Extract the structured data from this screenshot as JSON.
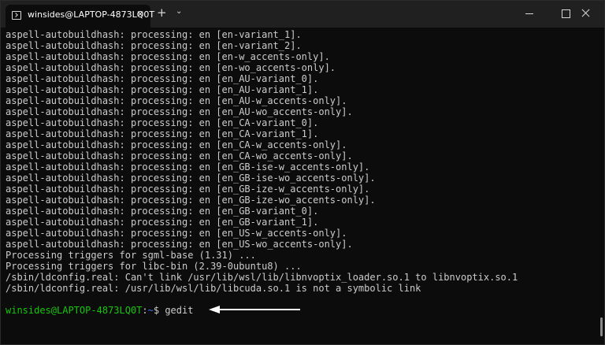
{
  "tab": {
    "title": "winsides@LAPTOP-4873LQ0T",
    "close": "✕"
  },
  "titlebar": {
    "new_tab": "+",
    "dropdown": "⌄"
  },
  "output": [
    "aspell-autobuildhash: processing: en [en-variant_1].",
    "aspell-autobuildhash: processing: en [en-variant_2].",
    "aspell-autobuildhash: processing: en [en-w_accents-only].",
    "aspell-autobuildhash: processing: en [en-wo_accents-only].",
    "aspell-autobuildhash: processing: en [en_AU-variant_0].",
    "aspell-autobuildhash: processing: en [en_AU-variant_1].",
    "aspell-autobuildhash: processing: en [en_AU-w_accents-only].",
    "aspell-autobuildhash: processing: en [en_AU-wo_accents-only].",
    "aspell-autobuildhash: processing: en [en_CA-variant_0].",
    "aspell-autobuildhash: processing: en [en_CA-variant_1].",
    "aspell-autobuildhash: processing: en [en_CA-w_accents-only].",
    "aspell-autobuildhash: processing: en [en_CA-wo_accents-only].",
    "aspell-autobuildhash: processing: en [en_GB-ise-w_accents-only].",
    "aspell-autobuildhash: processing: en [en_GB-ise-wo_accents-only].",
    "aspell-autobuildhash: processing: en [en_GB-ize-w_accents-only].",
    "aspell-autobuildhash: processing: en [en_GB-ize-wo_accents-only].",
    "aspell-autobuildhash: processing: en [en_GB-variant_0].",
    "aspell-autobuildhash: processing: en [en_GB-variant_1].",
    "aspell-autobuildhash: processing: en [en_US-w_accents-only].",
    "aspell-autobuildhash: processing: en [en_US-wo_accents-only].",
    "Processing triggers for sgml-base (1.31) ...",
    "Processing triggers for libc-bin (2.39-0ubuntu8) ...",
    "/sbin/ldconfig.real: Can't link /usr/lib/wsl/lib/libnvoptix_loader.so.1 to libnvoptix.so.1",
    "/sbin/ldconfig.real: /usr/lib/wsl/lib/libcuda.so.1 is not a symbolic link"
  ],
  "prompt": {
    "user_host": "winsides@LAPTOP-4873LQ0T",
    "separator": ":",
    "path": "~",
    "symbol": "$ ",
    "command": "gedit"
  },
  "colors": {
    "background": "#0c0c0c",
    "titlebar": "#202020",
    "text": "#cccccc",
    "prompt_user": "#16c60c",
    "prompt_path": "#3b78ff",
    "arrow": "#ffffff"
  },
  "icons": {
    "tab": "terminal-icon",
    "minimize": "minimize-icon",
    "maximize": "maximize-icon",
    "close": "close-icon",
    "annotation": "arrow-left-icon"
  }
}
